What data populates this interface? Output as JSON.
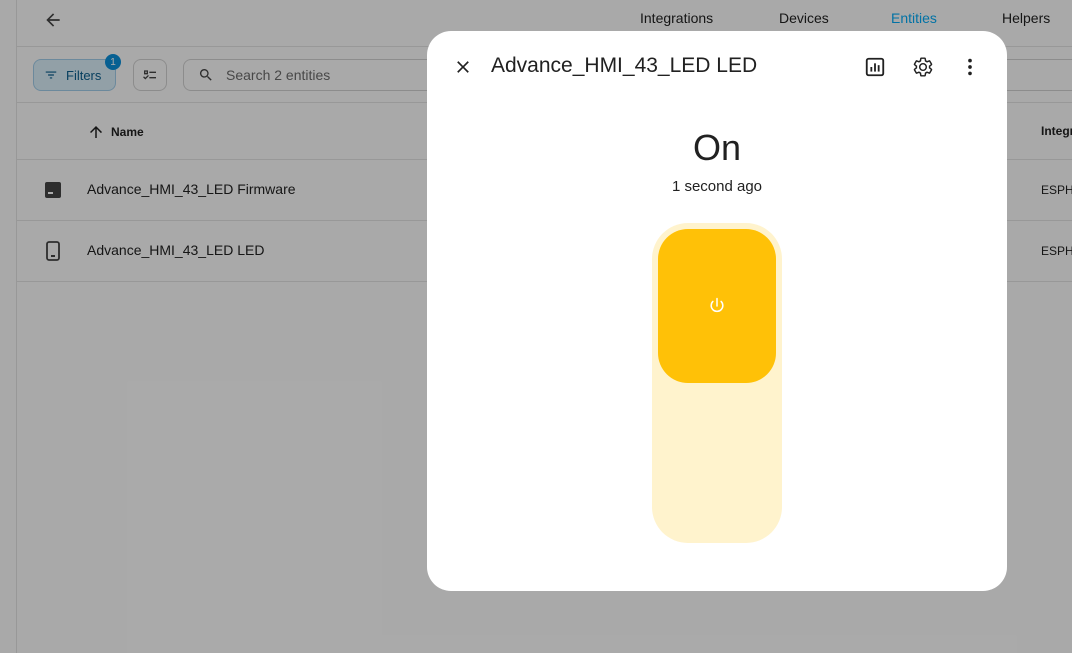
{
  "topbar": {
    "tabs": [
      {
        "label": "Integrations",
        "active": false
      },
      {
        "label": "Devices",
        "active": false
      },
      {
        "label": "Entities",
        "active": true
      },
      {
        "label": "Helpers",
        "active": false
      }
    ]
  },
  "toolbar": {
    "filters_label": "Filters",
    "filters_count": "1",
    "search_placeholder": "Search 2 entities"
  },
  "table": {
    "columns": {
      "name": "Name",
      "integration": "Integr"
    },
    "rows": [
      {
        "name": "Advance_HMI_43_LED Firmware",
        "integration": "ESPH",
        "icon": "firmware-icon"
      },
      {
        "name": "Advance_HMI_43_LED LED",
        "integration": "ESPH",
        "icon": "device-icon"
      }
    ]
  },
  "dialog": {
    "title": "Advance_HMI_43_LED LED",
    "state": "On",
    "last_changed": "1 second ago",
    "toggle_on": true
  },
  "colors": {
    "accent": "#03a9f4",
    "toggle_on": "#ffc107",
    "toggle_track": "#fff3cd"
  }
}
